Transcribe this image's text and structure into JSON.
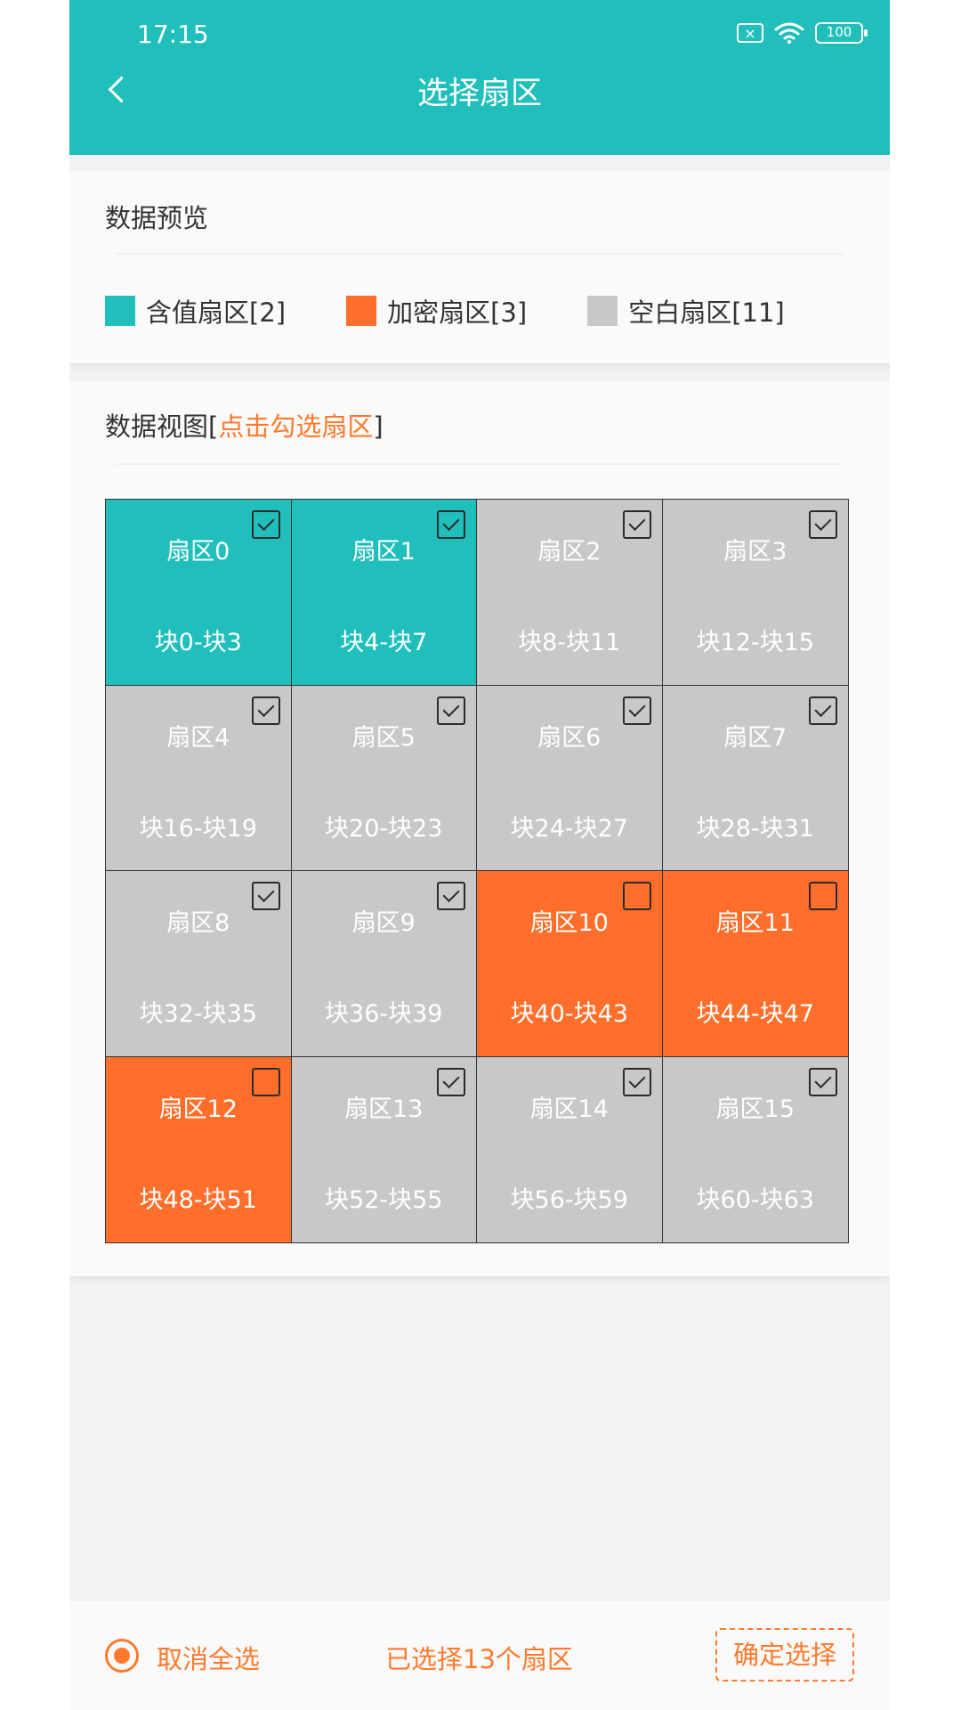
{
  "status_bar": {
    "time": "17:15",
    "battery": "100"
  },
  "header": {
    "title": "选择扇区"
  },
  "preview": {
    "title": "数据预览",
    "legend": [
      {
        "label": "含值扇区[2]",
        "color": "#20bfbb"
      },
      {
        "label": "加密扇区[3]",
        "color": "#ff6f2b"
      },
      {
        "label": "空白扇区[11]",
        "color": "#c8c8c8"
      }
    ]
  },
  "view": {
    "title_prefix": "数据视图[",
    "title_highlight": "点击勾选扇区",
    "title_suffix": "]",
    "sectors": [
      {
        "name": "扇区0",
        "blocks": "块0-块3",
        "type": "value",
        "checked": true
      },
      {
        "name": "扇区1",
        "blocks": "块4-块7",
        "type": "value",
        "checked": true
      },
      {
        "name": "扇区2",
        "blocks": "块8-块11",
        "type": "blank",
        "checked": true
      },
      {
        "name": "扇区3",
        "blocks": "块12-块15",
        "type": "blank",
        "checked": true
      },
      {
        "name": "扇区4",
        "blocks": "块16-块19",
        "type": "blank",
        "checked": true
      },
      {
        "name": "扇区5",
        "blocks": "块20-块23",
        "type": "blank",
        "checked": true
      },
      {
        "name": "扇区6",
        "blocks": "块24-块27",
        "type": "blank",
        "checked": true
      },
      {
        "name": "扇区7",
        "blocks": "块28-块31",
        "type": "blank",
        "checked": true
      },
      {
        "name": "扇区8",
        "blocks": "块32-块35",
        "type": "blank",
        "checked": true
      },
      {
        "name": "扇区9",
        "blocks": "块36-块39",
        "type": "blank",
        "checked": true
      },
      {
        "name": "扇区10",
        "blocks": "块40-块43",
        "type": "encrypted",
        "checked": false
      },
      {
        "name": "扇区11",
        "blocks": "块44-块47",
        "type": "encrypted",
        "checked": false
      },
      {
        "name": "扇区12",
        "blocks": "块48-块51",
        "type": "encrypted",
        "checked": false
      },
      {
        "name": "扇区13",
        "blocks": "块52-块55",
        "type": "blank",
        "checked": true
      },
      {
        "name": "扇区14",
        "blocks": "块56-块59",
        "type": "blank",
        "checked": true
      },
      {
        "name": "扇区15",
        "blocks": "块60-块63",
        "type": "blank",
        "checked": true
      }
    ]
  },
  "footer": {
    "deselect_label": "取消全选",
    "selected_count": "已选择13个扇区",
    "confirm_label": "确定选择"
  }
}
